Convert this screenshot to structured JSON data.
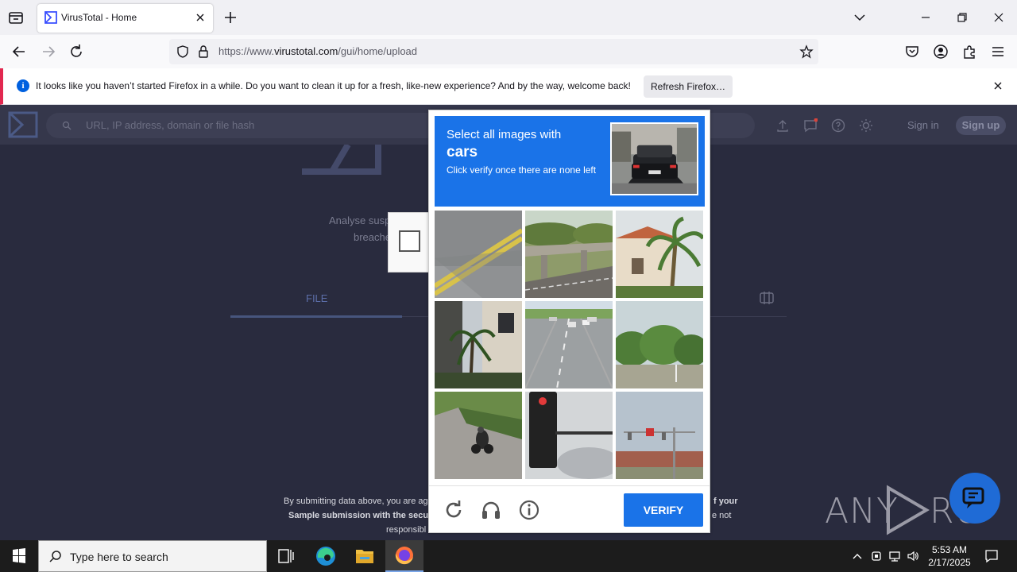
{
  "browser": {
    "tab_title": "VirusTotal - Home",
    "url_prefix": "https://www.",
    "url_host": "virustotal.com",
    "url_path": "/gui/home/upload"
  },
  "notification": {
    "message": "It looks like you haven’t started Firefox in a while. Do you want to clean it up for a fresh, like-new experience? And by the way, welcome back!",
    "button_label": "Refresh Firefox…"
  },
  "virustotal": {
    "search_placeholder": "URL, IP address, domain or file hash",
    "sign_in": "Sign in",
    "sign_up": "Sign up",
    "subtitle_line1": "Analyse susp",
    "subtitle_line2": "breache",
    "tab_file": "FILE",
    "footer_line1_a": "By submitting data above, you are ag",
    "footer_line1_b": "f your",
    "footer_line2_a": "Sample submission with the secur",
    "footer_line2_b": "e not",
    "footer_line3": "responsibl"
  },
  "captcha": {
    "line1": "Select all images with",
    "target": "cars",
    "line3": "Click verify once there are none left",
    "verify_label": "VERIFY",
    "tiles": [
      "road-markings",
      "bridge",
      "palm-house",
      "palm-building",
      "highway-cars",
      "trees",
      "motorcycle",
      "traffic-light",
      "traffic-signal-pole"
    ]
  },
  "watermark": "ANY RUN",
  "taskbar": {
    "search_text": "Type here to search",
    "time": "5:53 AM",
    "date": "2/17/2025"
  },
  "colors": {
    "accent": "#1a73e8",
    "vt_bg": "#292b3e",
    "notif_border": "#e22850"
  }
}
